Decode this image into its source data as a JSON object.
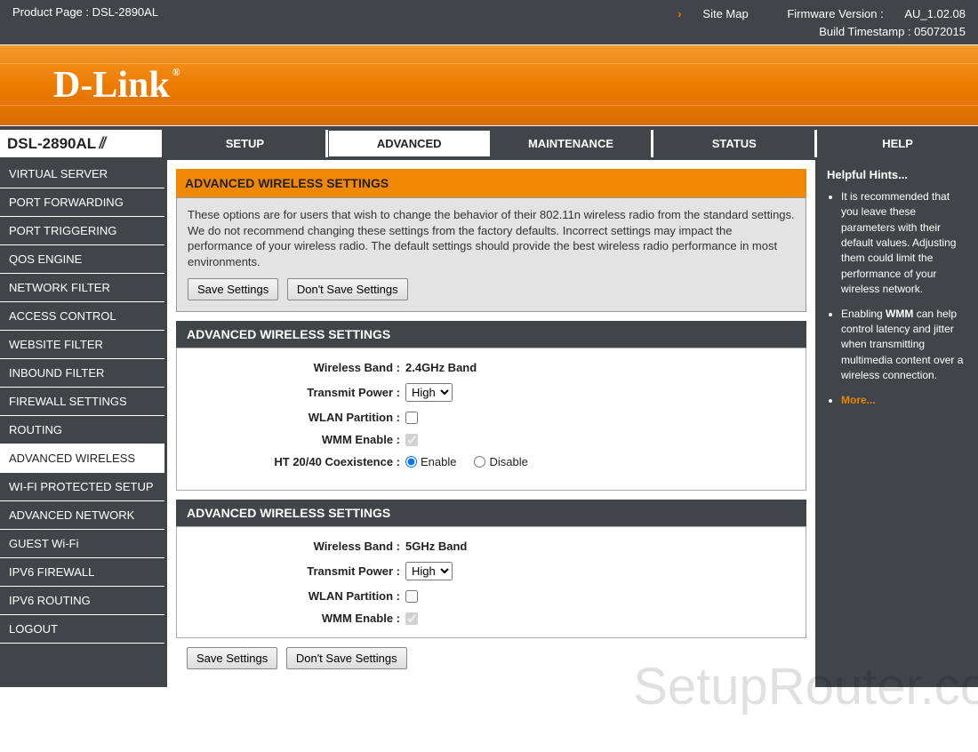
{
  "topbar": {
    "product_page_label": "Product Page : ",
    "product_page_value": "DSL-2890AL",
    "site_map": "Site Map",
    "firmware_label": "Firmware Version : ",
    "firmware_value": "AU_1.02.08",
    "build_label": "Build Timestamp : ",
    "build_value": "05072015"
  },
  "banner": {
    "brand": "D-Link"
  },
  "nav": {
    "model": "DSL-2890AL",
    "tabs": [
      "SETUP",
      "ADVANCED",
      "MAINTENANCE",
      "STATUS",
      "HELP"
    ],
    "active": "ADVANCED"
  },
  "sidebar": {
    "items": [
      "VIRTUAL SERVER",
      "PORT FORWARDING",
      "PORT TRIGGERING",
      "QOS ENGINE",
      "NETWORK FILTER",
      "ACCESS CONTROL",
      "WEBSITE FILTER",
      "INBOUND FILTER",
      "FIREWALL SETTINGS",
      "ROUTING",
      "ADVANCED WIRELESS",
      "WI-FI PROTECTED SETUP",
      "ADVANCED NETWORK",
      "GUEST Wi-Fi",
      "IPV6 FIREWALL",
      "IPV6 ROUTING",
      "LOGOUT"
    ],
    "active": "ADVANCED WIRELESS"
  },
  "main": {
    "title": "ADVANCED WIRELESS SETTINGS",
    "intro": "These options are for users that wish to change the behavior of their 802.11n wireless radio from the standard settings. We do not recommend changing these settings from the factory defaults. Incorrect settings may impact the performance of your wireless radio. The default settings should provide the best wireless radio performance in most environments.",
    "save_btn": "Save Settings",
    "dont_save_btn": "Don't Save Settings",
    "section_title": "ADVANCED WIRELESS SETTINGS",
    "labels": {
      "band": "Wireless Band :",
      "power": "Transmit Power :",
      "wlanp": "WLAN Partition :",
      "wmm": "WMM Enable :",
      "ht": "HT 20/40 Coexistence :"
    },
    "band24": {
      "band": "2.4GHz Band",
      "power": "High",
      "wlan_partition": false,
      "wmm": true,
      "ht_enable_label": "Enable",
      "ht_disable_label": "Disable",
      "ht": "Enable"
    },
    "band5": {
      "band": "5GHz Band",
      "power": "High",
      "wlan_partition": false,
      "wmm": true
    }
  },
  "help": {
    "hdr": "Helpful Hints...",
    "hint1": "It is recommended that you leave these parameters with their default values. Adjusting them could limit the performance of your wireless network.",
    "hint2_a": "Enabling ",
    "hint2_b": "WMM",
    "hint2_c": " can help control latency and jitter when transmitting multimedia content over a wireless connection.",
    "more": "More..."
  },
  "watermark": "SetupRouter.co"
}
